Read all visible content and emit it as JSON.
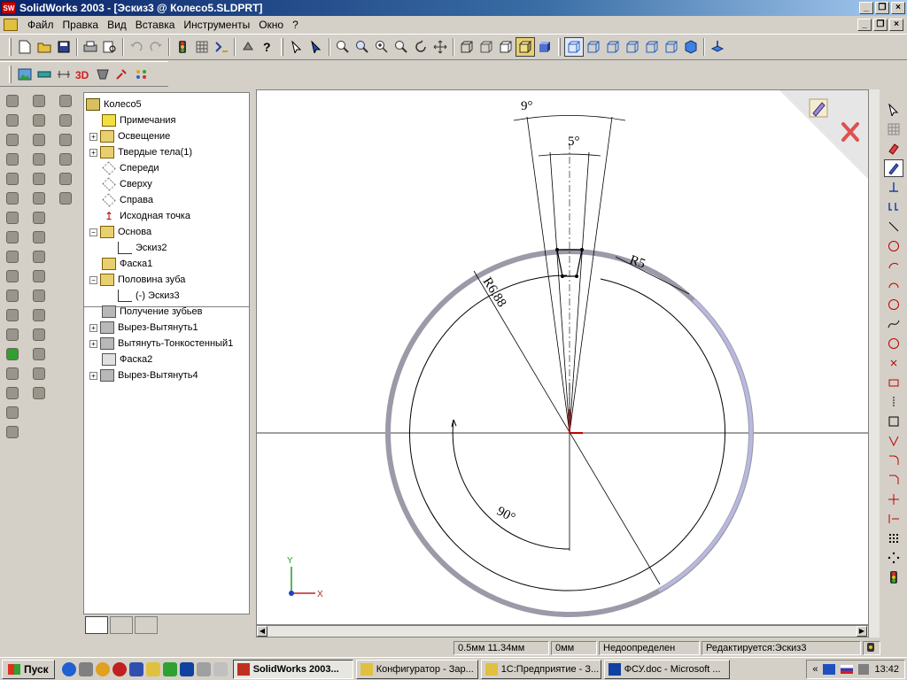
{
  "window": {
    "title": "SolidWorks 2003 - [Эскиз3 @ Колесо5.SLDPRT]",
    "app_icon_text": "SW"
  },
  "menu": {
    "items": [
      "Файл",
      "Правка",
      "Вид",
      "Вставка",
      "Инструменты",
      "Окно",
      "?"
    ]
  },
  "feature_tree": {
    "root": "Колесо5",
    "items": [
      {
        "label": "Примечания",
        "icon": "annotations-icon",
        "expandable": false
      },
      {
        "label": "Освещение",
        "icon": "lighting-icon",
        "expandable": true
      },
      {
        "label": "Твердые тела(1)",
        "icon": "solid-bodies-icon",
        "expandable": true
      },
      {
        "label": "Спереди",
        "icon": "plane-icon",
        "expandable": false
      },
      {
        "label": "Сверху",
        "icon": "plane-icon",
        "expandable": false
      },
      {
        "label": "Справа",
        "icon": "plane-icon",
        "expandable": false
      },
      {
        "label": "Исходная точка",
        "icon": "origin-icon",
        "expandable": false
      },
      {
        "label": "Основа",
        "icon": "extrude-icon",
        "expandable": true
      },
      {
        "label": "Эскиз2",
        "icon": "sketch-icon",
        "expandable": false
      },
      {
        "label": "Фаска1",
        "icon": "chamfer-icon",
        "expandable": false
      },
      {
        "label": "Половина зуба",
        "icon": "extrude-icon",
        "expandable": true
      },
      {
        "label": "(-) Эскиз3",
        "icon": "sketch-icon",
        "expandable": false
      },
      {
        "label": "Получение зубьев",
        "icon": "pattern-icon",
        "expandable": false
      },
      {
        "label": "Вырез-Вытянуть1",
        "icon": "cut-extrude-icon",
        "expandable": true
      },
      {
        "label": "Вытянуть-Тонкостенный1",
        "icon": "thin-extrude-icon",
        "expandable": true
      },
      {
        "label": "Фаска2",
        "icon": "chamfer-icon",
        "expandable": false
      },
      {
        "label": "Вырез-Вытянуть4",
        "icon": "cut-extrude-icon",
        "expandable": true
      }
    ]
  },
  "sketch": {
    "dimensions": {
      "angle_outer": "9°",
      "angle_inner": "5°",
      "radius_large": "R6.88",
      "radius_small": "R5",
      "angle_arc": "90°"
    },
    "axes": {
      "x": "X",
      "y": "Y"
    }
  },
  "status": {
    "coords": "0.5мм 11.34мм",
    "z": "0мм",
    "definition": "Недоопределен",
    "editing": "Редактируется:Эскиз3"
  },
  "taskbar": {
    "start_label": "Пуск",
    "tasks": [
      {
        "label": "SolidWorks 2003...",
        "active": true
      },
      {
        "label": "Конфигуратор - Зар...",
        "active": false
      },
      {
        "label": "1С:Предприятие - З...",
        "active": false
      },
      {
        "label": "ФСУ.doc - Microsoft ...",
        "active": false
      }
    ],
    "tray_arrow": "«",
    "clock": "13:42"
  },
  "colors": {
    "title_active": "#0a246a",
    "sketch_line": "#000000",
    "gear_rim": "#9a9aa8",
    "origin_red": "#c00000"
  }
}
